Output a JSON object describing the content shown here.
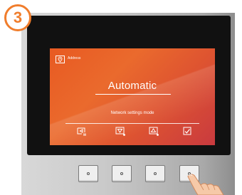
{
  "step": {
    "number": "3",
    "color": "#f07d2c"
  },
  "screen": {
    "header": {
      "icon": "address-pin-icon",
      "label": "Address"
    },
    "mode_value": "Automatic",
    "mode_caption": "Network settings mode",
    "softkeys": [
      {
        "icon": "back-list-icon"
      },
      {
        "icon": "arrow-down-icon"
      },
      {
        "icon": "arrow-up-icon"
      },
      {
        "icon": "confirm-check-icon"
      }
    ],
    "gradient": [
      "#e85a22",
      "#c93a3f"
    ]
  },
  "hardware_buttons": [
    {
      "name": "button-1"
    },
    {
      "name": "button-2"
    },
    {
      "name": "button-3"
    },
    {
      "name": "button-4",
      "pressed": true
    }
  ]
}
